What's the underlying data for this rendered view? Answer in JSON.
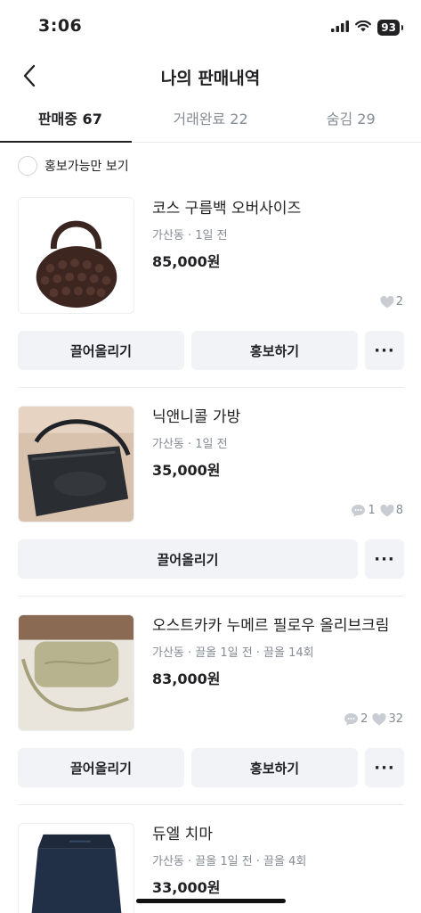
{
  "status_bar": {
    "time": "3:06",
    "battery": "93"
  },
  "header": {
    "title": "나의 판매내역"
  },
  "tabs": [
    {
      "label": "판매중 67"
    },
    {
      "label": "거래완료 22"
    },
    {
      "label": "숨김 29"
    }
  ],
  "filter": {
    "label": "홍보가능만 보기"
  },
  "items": [
    {
      "title": "코스 구름백 오버사이즈",
      "meta": "가산동 · 1일 전",
      "price": "85,000원",
      "likes": "2",
      "buttons": {
        "bump": "끌어올리기",
        "promote": "홍보하기",
        "more": "···"
      }
    },
    {
      "title": "닉앤니콜 가방",
      "meta": "가산동 · 1일 전",
      "price": "35,000원",
      "chats": "1",
      "likes": "8",
      "buttons": {
        "bump": "끌어올리기",
        "more": "···"
      }
    },
    {
      "title": "오스트카카 누메르 필로우 올리브크림",
      "meta": "가산동 · 끌올 1일 전 · 끌올 14회",
      "price": "83,000원",
      "chats": "2",
      "likes": "32",
      "buttons": {
        "bump": "끌어올리기",
        "promote": "홍보하기",
        "more": "···"
      }
    },
    {
      "title": "듀엘 치마",
      "meta": "가산동 · 끌올 1일 전 · 끌올 4회",
      "price": "33,000원"
    }
  ]
}
